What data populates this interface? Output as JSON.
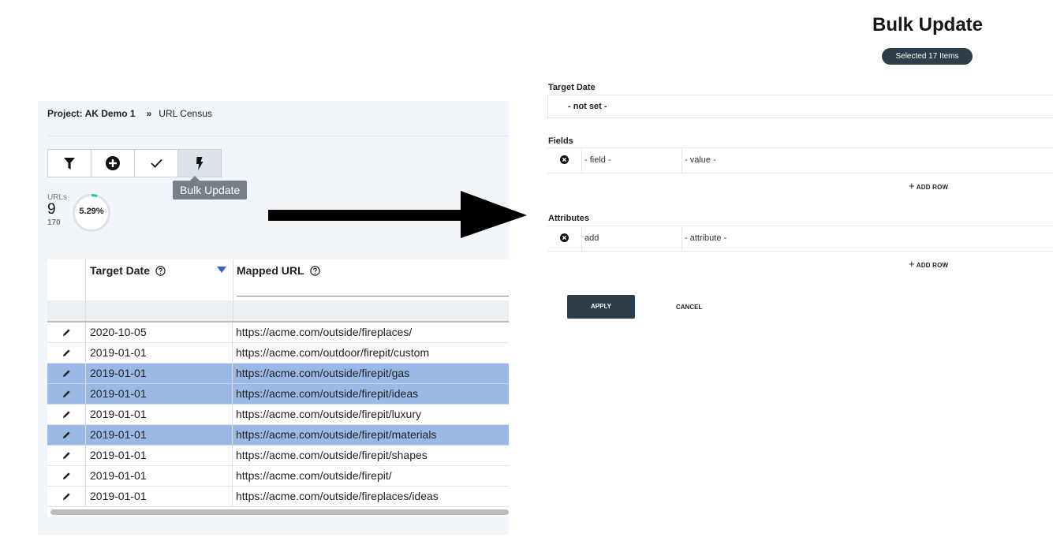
{
  "breadcrumb": {
    "project": "Project: AK Demo 1",
    "separator": "»",
    "page": "URL Census"
  },
  "toolbar": {
    "buttons": [
      {
        "icon": "filter-icon"
      },
      {
        "icon": "plus-circle-icon"
      },
      {
        "icon": "check-icon"
      },
      {
        "icon": "lightning-icon",
        "active": true
      }
    ],
    "tooltip": "Bulk Update"
  },
  "stats": {
    "label": "URLs",
    "count": "9",
    "total": "170",
    "percent_label": "5.29%",
    "percent_value": 0.0529
  },
  "grid": {
    "columns": [
      {
        "title": "Target Date",
        "help_icon": "help-circle-icon",
        "sort": "descending"
      },
      {
        "title": "Mapped URL",
        "help_icon": "help-circle-icon"
      }
    ],
    "rows": [
      {
        "date": "2020-10-05",
        "url": "https://acme.com/outside/fireplaces/",
        "selected": false
      },
      {
        "date": "2019-01-01",
        "url": "https://acme.com/outdoor/firepit/custom",
        "selected": false
      },
      {
        "date": "2019-01-01",
        "url": "https://acme.com/outside/firepit/gas",
        "selected": true
      },
      {
        "date": "2019-01-01",
        "url": "https://acme.com/outside/firepit/ideas",
        "selected": true
      },
      {
        "date": "2019-01-01",
        "url": "https://acme.com/outside/firepit/luxury",
        "selected": false
      },
      {
        "date": "2019-01-01",
        "url": "https://acme.com/outside/firepit/materials",
        "selected": true
      },
      {
        "date": "2019-01-01",
        "url": "https://acme.com/outside/firepit/shapes",
        "selected": false
      },
      {
        "date": "2019-01-01",
        "url": "https://acme.com/outside/firepit/",
        "selected": false
      },
      {
        "date": "2019-01-01",
        "url": "https://acme.com/outside/fireplaces/ideas",
        "selected": false
      }
    ],
    "selected_color": "#9ab9e6"
  },
  "bulk_update": {
    "title": "Bulk Update",
    "badge": "Selected 17 Items",
    "target_date": {
      "label": "Target Date",
      "value": "- not set -"
    },
    "fields": {
      "label": "Fields",
      "key": "- field -",
      "value": "- value -",
      "add_row": "ADD ROW"
    },
    "attributes": {
      "label": "Attributes",
      "key": "add",
      "value": "- attribute -",
      "add_row": "ADD ROW"
    },
    "apply_label": "APPLY",
    "cancel_label": "CANCEL",
    "accent_color": "#2d3d4b"
  }
}
